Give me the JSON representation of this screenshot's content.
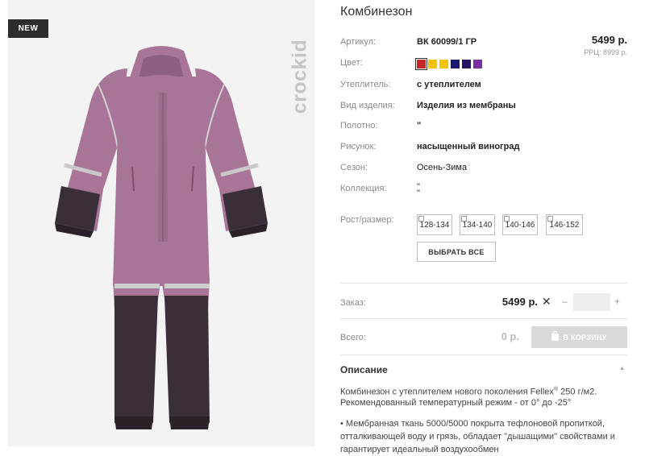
{
  "badge": "NEW",
  "brand": "crockid",
  "product": {
    "title": "Комбинезон",
    "price": "5499 р.",
    "rrc": "РРЦ: 8999 р."
  },
  "attributes": [
    {
      "label": "Артикул:",
      "value": "ВК 60099/1 ГР",
      "bold": true
    },
    {
      "label": "Цвет:",
      "value": ""
    },
    {
      "label": "Утеплитель:",
      "value": "с утеплителем",
      "bold": true
    },
    {
      "label": "Вид изделия:",
      "value": "Изделия из мембраны",
      "bold": true
    },
    {
      "label": "Полотно:",
      "value": "\"",
      "bold": true
    },
    {
      "label": "Рисунок:",
      "value": "насыщенный виноград",
      "bold": true
    },
    {
      "label": "Сезон:",
      "value": "Осень-Зима",
      "bold": false
    },
    {
      "label": "Коллекция:",
      "value": "\"",
      "value2": "\"",
      "bold": false
    }
  ],
  "colors": [
    "#c62828",
    "#f2c200",
    "#f2c200",
    "#1a1a6e",
    "#231466",
    "#7b2ea0"
  ],
  "sizes": {
    "label": "Рост/размер:",
    "options": [
      "128-134",
      "134-140",
      "140-146",
      "146-152"
    ],
    "select_all": "ВЫБРАТЬ ВСЕ"
  },
  "order": {
    "label": "Заказ:",
    "price": "5499 р.",
    "times": "✕",
    "minus": "–",
    "plus": "+",
    "quantity": ""
  },
  "total": {
    "label": "Всего:",
    "value": "0 р.",
    "cart_button": "В КОРЗИНУ"
  },
  "description": {
    "title": "Описание",
    "toggle": "▲",
    "p1_a": "Комбинезон с утеплителем нового поколения Fellex",
    "p1_sup": "®",
    "p1_b": " 250 г/м2.",
    "p2": "Рекомендованный температурный режим - от 0° до -25°",
    "p3_l1": "• Мембранная ткань 5000/5000 покрыта тефлоновой пропиткой,",
    "p3_l2": "отталкивающей воду и грязь, обладает \"дышащими\" свойствами и",
    "p3_l3": "гарантирует идеальный воздухообмен"
  }
}
